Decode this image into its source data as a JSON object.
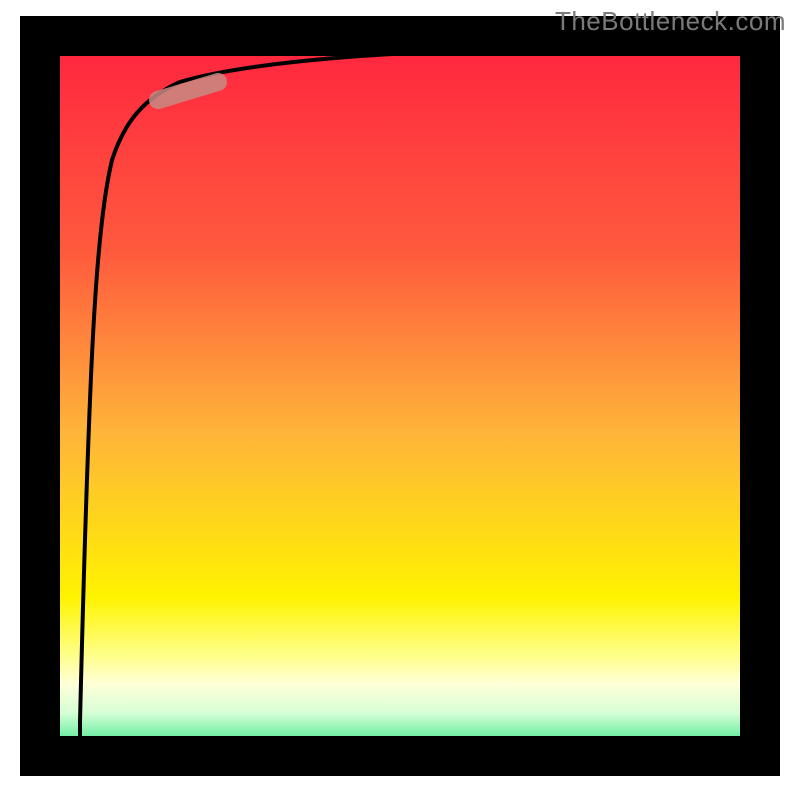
{
  "watermark": "TheBottleneck.com",
  "chart_data": {
    "type": "line",
    "title": "",
    "xlabel": "",
    "ylabel": "",
    "xlim": [
      0,
      100
    ],
    "ylim": [
      0,
      100
    ],
    "grid": false,
    "legend": "none",
    "background_gradient": {
      "top": "#ff233f",
      "mid1_orange": "#ff7a3a",
      "mid2_yellow": "#fff300",
      "band_paleyellow": "#ffffcc",
      "bottom": "#1ee07b"
    },
    "series": [
      {
        "name": "curve",
        "x": [
          3.5,
          4,
          4.5,
          5,
          6,
          8,
          10,
          14,
          20,
          30,
          45,
          60,
          80,
          100
        ],
        "y": [
          2,
          30,
          55,
          70,
          80,
          86,
          89,
          91.5,
          93,
          94,
          95,
          95.6,
          96.2,
          96.6
        ]
      }
    ],
    "highlight_segment": {
      "x_start": 12,
      "y_start": 90,
      "x_end": 22,
      "y_end": 92.5,
      "color": "#c88a84"
    }
  }
}
